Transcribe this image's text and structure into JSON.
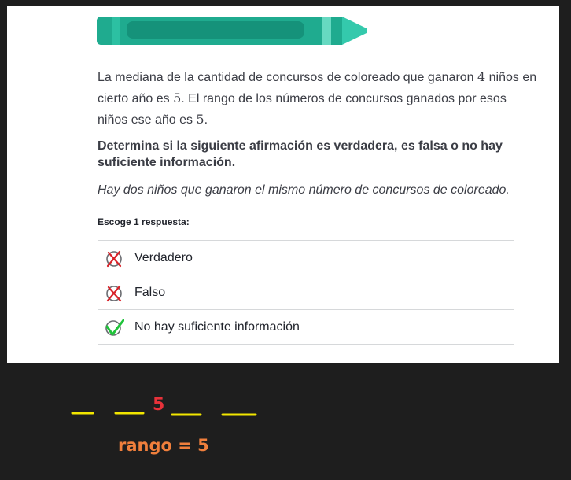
{
  "problem": {
    "part1": "La mediana de la cantidad de concursos de coloreado que ganaron ",
    "num1": "4",
    "part2": " niños en cierto año es ",
    "num2": "5",
    "part3": ". El rango de los números de concursos ganados por esos niños ese año es ",
    "num3": "5",
    "part4": "."
  },
  "instruction": "Determina si la siguiente afirmación es verdadera, es falsa o no hay suficiente información.",
  "statement": "Hay dos niños que ganaron el mismo número de concursos de coloreado.",
  "choose_label": "Escoge 1 respuesta:",
  "options": [
    {
      "label": "Verdadero",
      "state": "incorrect"
    },
    {
      "label": "Falso",
      "state": "incorrect"
    },
    {
      "label": "No hay suficiente información",
      "state": "correct"
    }
  ],
  "scratchpad": {
    "median_mark": "5",
    "range_note": "rango = 5"
  },
  "colors": {
    "crayon": "#1fab8f",
    "correct": "#1fc33a",
    "incorrect": "#d9232a",
    "scratch_yellow": "#f2e600",
    "scratch_red": "#e8323a",
    "scratch_orange": "#f07f3c"
  }
}
